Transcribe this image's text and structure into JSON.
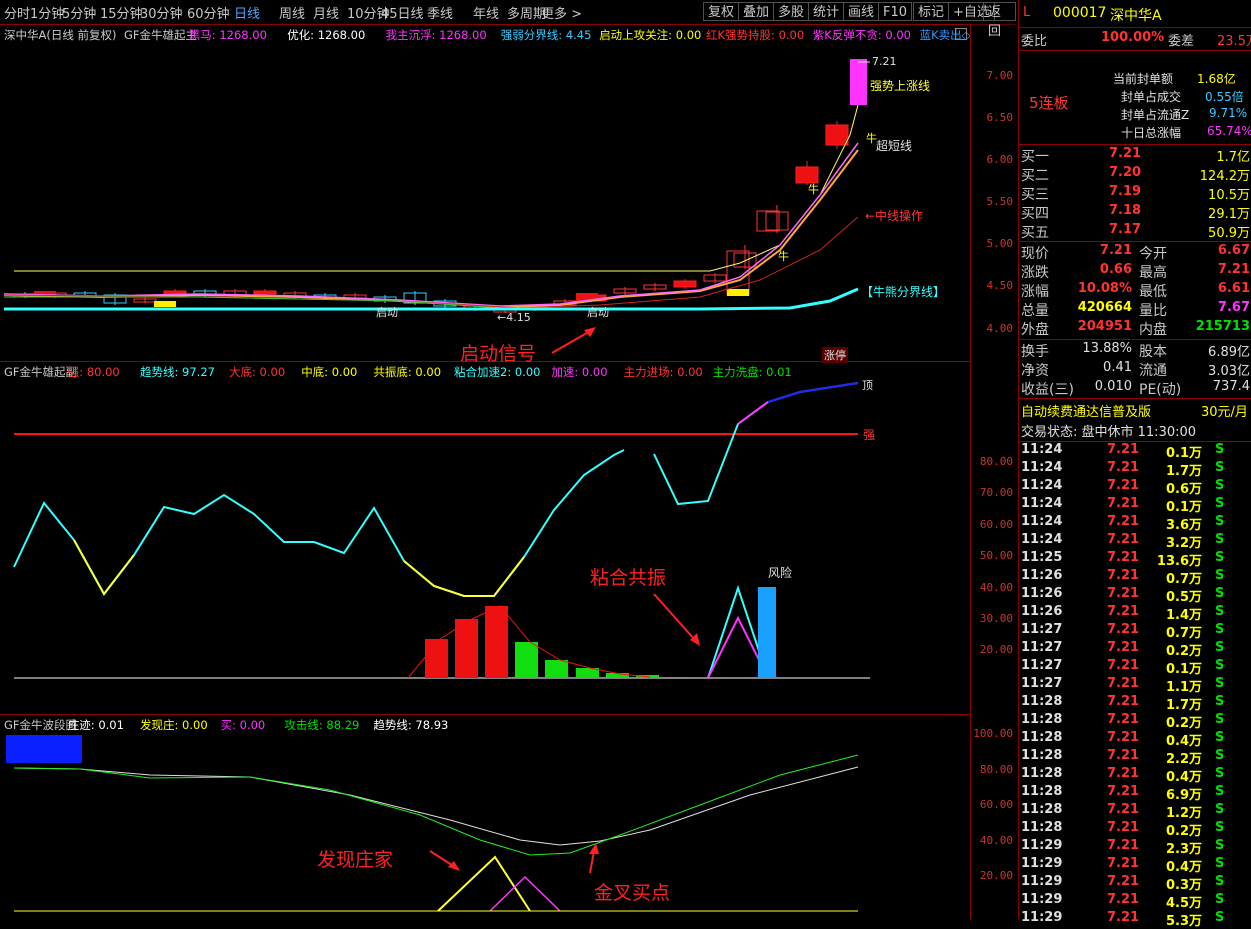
{
  "toolbar": {
    "periods": [
      "分时",
      "1分钟",
      "5分钟",
      "15分钟",
      "30分钟",
      "60分钟",
      "日线",
      "周线",
      "月线",
      "10分钟",
      "45日线",
      "季线",
      "年线",
      "多周期",
      "更多 >"
    ],
    "active_period": "日线",
    "right_buttons": [
      "复权",
      "叠加",
      "多股",
      "统计",
      "画线",
      "F10",
      "标记",
      "+自选",
      "返回"
    ]
  },
  "main_panel": {
    "title": "深中华A(日线 前复权)",
    "indicators": [
      {
        "label": "GF金牛雄起主",
        "color": "#c8c8c8"
      },
      {
        "label": "黑马: 1268.00",
        "color": "#ff33ff"
      },
      {
        "label": "优化: 1268.00",
        "color": "#ffffff"
      },
      {
        "label": "我主沉浮: 1268.00",
        "color": "#ff33ff"
      },
      {
        "label": "强弱分界线: 4.45",
        "color": "#33ccff"
      },
      {
        "label": "启动上攻关注: 0.00",
        "color": "#ffff00"
      },
      {
        "label": "红K强势持股: 0.00",
        "color": "#ff3333"
      },
      {
        "label": "紫K反弹不贪: 0.00",
        "color": "#ff33ff"
      },
      {
        "label": "蓝K卖出◇",
        "color": "#3399ff"
      }
    ],
    "y_ticks": [
      "7.00",
      "6.50",
      "6.00",
      "5.50",
      "5.00",
      "4.50",
      "4.00"
    ],
    "labels": {
      "high_price": "7.21",
      "strong_line": "强势上涨线",
      "bull1": "牛",
      "bull2": "牛",
      "bull3": "牛",
      "super_short": "超短线",
      "mid_line": "←中线操作",
      "bear_bull_line": "【牛熊分界线】",
      "start1": "启动",
      "start2": "启动",
      "low_price": "←4.15",
      "limit_up": "涨停",
      "signal": "启动信号"
    }
  },
  "sub_panel1": {
    "indicators": [
      {
        "label": "GF金牛雄起副",
        "color": "#c8c8c8"
      },
      {
        "label": "强: 80.00",
        "color": "#ff3333"
      },
      {
        "label": "趋势线: 97.27",
        "color": "#33ffff"
      },
      {
        "label": "大底: 0.00",
        "color": "#ff3333"
      },
      {
        "label": "中底: 0.00",
        "color": "#ffff00"
      },
      {
        "label": "共振底: 0.00",
        "color": "#ffff00"
      },
      {
        "label": "粘合加速2: 0.00",
        "color": "#33ffff"
      },
      {
        "label": "加速: 0.00",
        "color": "#ff33ff"
      },
      {
        "label": "主力进场: 0.00",
        "color": "#ff3333"
      },
      {
        "label": "主力洗盘: 0.01",
        "color": "#00e000"
      }
    ],
    "y_ticks": [
      "80.00",
      "70.00",
      "60.00",
      "50.00",
      "40.00",
      "30.00",
      "20.00"
    ],
    "labels": {
      "strong": "强",
      "top": "顶",
      "risk": "风险",
      "resonance": "粘合共振"
    }
  },
  "sub_panel2": {
    "indicators": [
      {
        "label": "GF金牛波段图",
        "color": "#c8c8c8"
      },
      {
        "label": "庄迹: 0.01",
        "color": "#ffffff"
      },
      {
        "label": "发现庄: 0.00",
        "color": "#ffff00"
      },
      {
        "label": "买: 0.00",
        "color": "#ff33ff"
      },
      {
        "label": "攻击线: 88.29",
        "color": "#00e000"
      },
      {
        "label": "趋势线: 78.93",
        "color": "#ffffff"
      }
    ],
    "y_ticks": [
      "100.00",
      "80.00",
      "60.00",
      "40.00",
      "20.00"
    ],
    "labels": {
      "find": "发现庄家",
      "cross": "金叉买点"
    }
  },
  "quote": {
    "code": "000017",
    "name": "深中华A",
    "ratio_label": "委比",
    "ratio": "100.00%",
    "diff_label": "委差",
    "diff": "23.5万",
    "streak": "5连板",
    "seal": [
      {
        "label": "当前封单额",
        "value": "1.68亿"
      },
      {
        "label": "封单占成交",
        "value": "0.55倍"
      },
      {
        "label": "封单占流通Z",
        "value": "9.71%"
      },
      {
        "label": "十日总涨幅",
        "value": "65.74%"
      }
    ],
    "bids": [
      {
        "label": "买一",
        "price": "7.21",
        "vol": "1.7亿"
      },
      {
        "label": "买二",
        "price": "7.20",
        "vol": "124.2万"
      },
      {
        "label": "买三",
        "price": "7.19",
        "vol": "10.5万"
      },
      {
        "label": "买四",
        "price": "7.18",
        "vol": "29.1万"
      },
      {
        "label": "买五",
        "price": "7.17",
        "vol": "50.9万"
      }
    ],
    "stats": [
      {
        "l1": "现价",
        "v1": "7.21",
        "l2": "今开",
        "v2": "6.67"
      },
      {
        "l1": "涨跌",
        "v1": "0.66",
        "l2": "最高",
        "v2": "7.21"
      },
      {
        "l1": "涨幅",
        "v1": "10.08%",
        "l2": "最低",
        "v2": "6.61"
      },
      {
        "l1": "总量",
        "v1": "420664",
        "l2": "量比",
        "v2": "7.67"
      },
      {
        "l1": "外盘",
        "v1": "204951",
        "l2": "内盘",
        "v2": "215713"
      }
    ],
    "stats2": [
      {
        "l1": "换手",
        "v1": "13.88%",
        "l2": "股本",
        "v2": "6.89亿"
      },
      {
        "l1": "净资",
        "v1": "0.41",
        "l2": "流通",
        "v2": "3.03亿"
      },
      {
        "l1": "收益(三)",
        "v1": "0.010",
        "l2": "PE(动)",
        "v2": "737.4"
      }
    ],
    "ad": "自动续费通达信普及版",
    "ad_price": "30元/月",
    "trade_status": "交易状态: 盘中休市 11:30:00",
    "ticks": [
      {
        "t": "11:24",
        "p": "7.21",
        "v": "0.1万",
        "s": "S"
      },
      {
        "t": "11:24",
        "p": "7.21",
        "v": "1.7万",
        "s": "S"
      },
      {
        "t": "11:24",
        "p": "7.21",
        "v": "0.6万",
        "s": "S"
      },
      {
        "t": "11:24",
        "p": "7.21",
        "v": "0.1万",
        "s": "S"
      },
      {
        "t": "11:24",
        "p": "7.21",
        "v": "3.6万",
        "s": "S"
      },
      {
        "t": "11:24",
        "p": "7.21",
        "v": "3.2万",
        "s": "S"
      },
      {
        "t": "11:25",
        "p": "7.21",
        "v": "13.6万",
        "s": "S"
      },
      {
        "t": "11:26",
        "p": "7.21",
        "v": "0.7万",
        "s": "S"
      },
      {
        "t": "11:26",
        "p": "7.21",
        "v": "0.5万",
        "s": "S"
      },
      {
        "t": "11:26",
        "p": "7.21",
        "v": "1.4万",
        "s": "S"
      },
      {
        "t": "11:27",
        "p": "7.21",
        "v": "0.7万",
        "s": "S"
      },
      {
        "t": "11:27",
        "p": "7.21",
        "v": "0.2万",
        "s": "S"
      },
      {
        "t": "11:27",
        "p": "7.21",
        "v": "0.1万",
        "s": "S"
      },
      {
        "t": "11:27",
        "p": "7.21",
        "v": "1.1万",
        "s": "S"
      },
      {
        "t": "11:28",
        "p": "7.21",
        "v": "1.7万",
        "s": "S"
      },
      {
        "t": "11:28",
        "p": "7.21",
        "v": "0.2万",
        "s": "S"
      },
      {
        "t": "11:28",
        "p": "7.21",
        "v": "0.4万",
        "s": "S"
      },
      {
        "t": "11:28",
        "p": "7.21",
        "v": "2.2万",
        "s": "S"
      },
      {
        "t": "11:28",
        "p": "7.21",
        "v": "0.4万",
        "s": "S"
      },
      {
        "t": "11:28",
        "p": "7.21",
        "v": "6.9万",
        "s": "S"
      },
      {
        "t": "11:28",
        "p": "7.21",
        "v": "1.2万",
        "s": "S"
      },
      {
        "t": "11:28",
        "p": "7.21",
        "v": "0.2万",
        "s": "S"
      },
      {
        "t": "11:29",
        "p": "7.21",
        "v": "2.3万",
        "s": "S"
      },
      {
        "t": "11:29",
        "p": "7.21",
        "v": "0.4万",
        "s": "S"
      },
      {
        "t": "11:29",
        "p": "7.21",
        "v": "0.3万",
        "s": "S"
      },
      {
        "t": "11:29",
        "p": "7.21",
        "v": "4.5万",
        "s": "S"
      },
      {
        "t": "11:29",
        "p": "7.21",
        "v": "5.3万",
        "s": "S"
      }
    ]
  }
}
